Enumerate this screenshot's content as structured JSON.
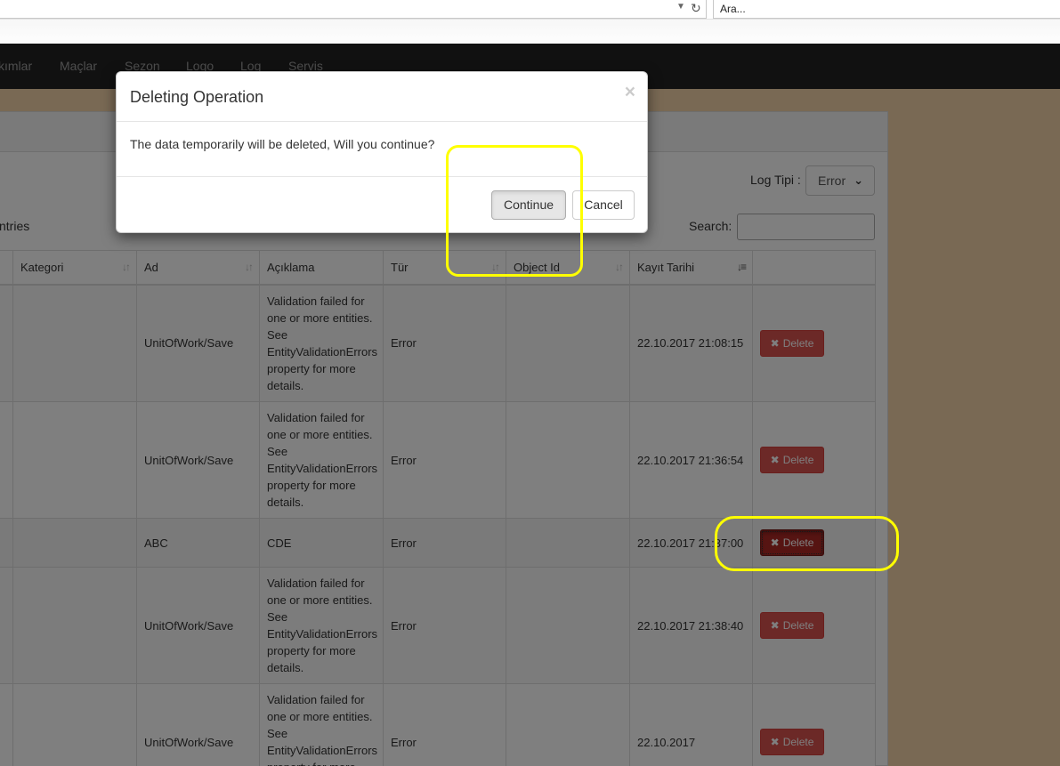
{
  "browser": {
    "search_placeholder": "Ara..."
  },
  "nav": {
    "items": [
      "kımlar",
      "Maçlar",
      "Sezon",
      "Logo",
      "Log",
      "Servis"
    ]
  },
  "filters": {
    "log_type_label": "Log Tipi :",
    "log_type_value": "Error",
    "entries_text": "ntries",
    "search_label": "Search:"
  },
  "table": {
    "headers": [
      "Kategori",
      "Ad",
      "Açıklama",
      "Tür",
      "Object Id",
      "Kayıt Tarihi"
    ],
    "rows": [
      {
        "kategori": "",
        "ad": "UnitOfWork/Save",
        "aciklama": "Validation failed for one or more entities. See EntityValidationErrors property for more details.",
        "tur": "Error",
        "object_id": "",
        "tarih": "22.10.2017 21:08:15",
        "action": "Delete"
      },
      {
        "kategori": "",
        "ad": "UnitOfWork/Save",
        "aciklama": "Validation failed for one or more entities. See EntityValidationErrors property for more details.",
        "tur": "Error",
        "object_id": "",
        "tarih": "22.10.2017 21:36:54",
        "action": "Delete"
      },
      {
        "kategori": "",
        "ad": "ABC",
        "aciklama": "CDE",
        "tur": "Error",
        "object_id": "",
        "tarih": "22.10.2017 21:37:00",
        "action": "Delete"
      },
      {
        "kategori": "",
        "ad": "UnitOfWork/Save",
        "aciklama": "Validation failed for one or more entities. See EntityValidationErrors property for more details.",
        "tur": "Error",
        "object_id": "",
        "tarih": "22.10.2017 21:38:40",
        "action": "Delete"
      },
      {
        "kategori": "",
        "ad": "UnitOfWork/Save",
        "aciklama": "Validation failed for one or more entities. See EntityValidationErrors property for more details.",
        "tur": "Error",
        "object_id": "",
        "tarih": "22.10.2017",
        "action": "Delete"
      }
    ]
  },
  "modal": {
    "title": "Deleting Operation",
    "close_glyph": "×",
    "message": "The data temporarily will be deleted, Will you continue?",
    "continue_label": "Continue",
    "cancel_label": "Cancel"
  },
  "colors": {
    "navbar": "#222222",
    "page_background": "#f2d3a8",
    "delete_button": "#d9534f",
    "highlight": "#ffff00"
  }
}
